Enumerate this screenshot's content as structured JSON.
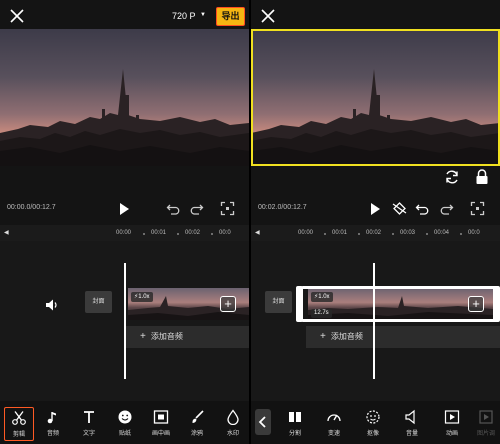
{
  "left_panel": {
    "header": {
      "resolution": "720 P",
      "resolution_caret": "▼",
      "export_label": "导出"
    },
    "playback": {
      "timecode": "00:00.0/00:12.7"
    },
    "ruler": {
      "ticks": [
        "00:00",
        "00:01",
        "00:02",
        "00:0"
      ]
    },
    "track": {
      "cover_label": "封面",
      "speed_label": "1.0x",
      "add_audio_label": "添加音频"
    },
    "toolbar": {
      "items": [
        {
          "label": "剪辑",
          "icon": "scissors-icon",
          "active": true
        },
        {
          "label": "音频",
          "icon": "music-note-icon"
        },
        {
          "label": "文字",
          "icon": "text-icon"
        },
        {
          "label": "贴纸",
          "icon": "sticker-icon"
        },
        {
          "label": "画中画",
          "icon": "picture-in-picture-icon"
        },
        {
          "label": "涂鸦",
          "icon": "brush-icon"
        },
        {
          "label": "水印",
          "icon": "watermark-icon"
        }
      ]
    }
  },
  "right_panel": {
    "playback": {
      "timecode": "00:02.0/00:12.7"
    },
    "ruler": {
      "ticks": [
        "00:00",
        "00:01",
        "00:02",
        "00:03",
        "00:04",
        "00:0"
      ]
    },
    "track": {
      "cover_label": "封面",
      "speed_label": "1.0x",
      "duration_label": "12.7s",
      "add_audio_label": "添加音频"
    },
    "toolbar": {
      "items": [
        {
          "label": "分割",
          "icon": "split-icon"
        },
        {
          "label": "变速",
          "icon": "speed-icon"
        },
        {
          "label": "抠像",
          "icon": "cutout-icon"
        },
        {
          "label": "音量",
          "icon": "volume-icon"
        },
        {
          "label": "动画",
          "icon": "animation-icon"
        },
        {
          "label": "图片调",
          "icon": "adjust-icon",
          "dimmed": true
        }
      ]
    }
  },
  "colors": {
    "accent": "#f5b512",
    "selection": "#f0e020",
    "active_tool": "#ff5a24"
  }
}
